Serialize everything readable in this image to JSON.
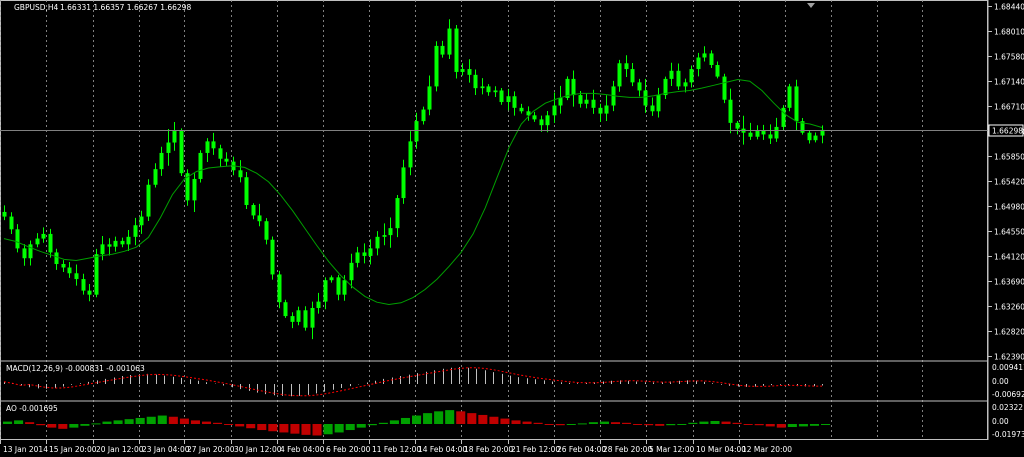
{
  "chart_header": {
    "symbol": "GBPUSD,H4",
    "ohlc": "1.66331 1.66357 1.66267 1.66298"
  },
  "current_price_tag": "1.66298",
  "colors": {
    "background": "#000000",
    "grid": "#a0a0a0",
    "bull_candle": "#00ff00",
    "ma_line": "#00a000",
    "macd_histogram": "#c0c0c0",
    "macd_signal": "#ff0000",
    "ao_up": "#00a000",
    "ao_down": "#c00000",
    "price_line": "#808080",
    "separator": "#c0c0c0"
  },
  "macd_panel": {
    "label": "MACD(12,26,9) -0.000831 -0.001063",
    "axis_labels": [
      "0.009411",
      "0.00",
      "-0.006925"
    ]
  },
  "ao_panel": {
    "label": "AO -0.001695",
    "axis_labels": [
      "0.02322",
      "0.00",
      "-0.019732"
    ]
  },
  "chart_data": {
    "type": "candlestick",
    "title": "GBPUSD,H4",
    "ylim": [
      1.6239,
      1.6844
    ],
    "y_ticks": [
      "1.68440",
      "1.68010",
      "1.67580",
      "1.67140",
      "1.66710",
      "1.66280",
      "1.65850",
      "1.65420",
      "1.64980",
      "1.64550",
      "1.64120",
      "1.63690",
      "1.63260",
      "1.62820",
      "1.62390"
    ],
    "x_ticks": [
      "13 Jan 2014",
      "15 Jan 20:00",
      "20 Jan 12:00",
      "23 Jan 04:00",
      "27 Jan 20:00",
      "30 Jan 12:00",
      "4 Feb 04:00",
      "6 Feb 20:00",
      "11 Feb 12:00",
      "14 Feb 04:00",
      "18 Feb 20:00",
      "21 Feb 12:00",
      "26 Feb 04:00",
      "28 Feb 20:00",
      "5 Mar 12:00",
      "10 Mar 04:00",
      "12 Mar 20:00"
    ],
    "close_path": [
      1.648,
      1.6458,
      1.6425,
      1.6408,
      1.6432,
      1.6442,
      1.645,
      1.6418,
      1.6398,
      1.6392,
      1.6382,
      1.6372,
      1.6352,
      1.6345,
      1.6415,
      1.6432,
      1.6428,
      1.6438,
      1.6432,
      1.6445,
      1.6465,
      1.648,
      1.6535,
      1.6562,
      1.659,
      1.6608,
      1.6628,
      1.6555,
      1.6508,
      1.6545,
      1.659,
      1.661,
      1.6598,
      1.658,
      1.6575,
      1.656,
      1.6548,
      1.65,
      1.6482,
      1.6472,
      1.644,
      1.638,
      1.6332,
      1.6308,
      1.6298,
      1.6318,
      1.6288,
      1.6322,
      1.6333,
      1.637,
      1.6375,
      1.6345,
      1.637,
      1.64,
      1.6418,
      1.6412,
      1.6425,
      1.6445,
      1.6448,
      1.646,
      1.6512,
      1.6565,
      1.661,
      1.6645,
      1.6665,
      1.6705,
      1.6775,
      1.676,
      1.6805,
      1.673,
      1.6735,
      1.6725,
      1.6702,
      1.6705,
      1.6695,
      1.6698,
      1.6678,
      1.6688,
      1.6668,
      1.6662,
      1.6655,
      1.6648,
      1.6638,
      1.6655,
      1.6672,
      1.6685,
      1.6718,
      1.669,
      1.6675,
      1.6682,
      1.6668,
      1.6658,
      1.6672,
      1.6705,
      1.6745,
      1.6735,
      1.6712,
      1.6698,
      1.6672,
      1.6662,
      1.669,
      1.6718,
      1.6732,
      1.6705,
      1.6712,
      1.6735,
      1.6755,
      1.6762,
      1.6742,
      1.6722,
      1.6682,
      1.6642,
      1.6632,
      1.6625,
      1.6618,
      1.6628,
      1.6622,
      1.6615,
      1.6635,
      1.6668,
      1.6705,
      1.6645,
      1.6625,
      1.6612,
      1.662,
      1.66298
    ],
    "ma_path": [
      1.6442,
      1.6437,
      1.6428,
      1.642,
      1.6413,
      1.6406,
      1.6404,
      1.6408,
      1.6412,
      1.6415,
      1.642,
      1.6427,
      1.6444,
      1.6478,
      1.6518,
      1.6545,
      1.6558,
      1.6564,
      1.6566,
      1.6568,
      1.6565,
      1.6555,
      1.654,
      1.6517,
      1.649,
      1.646,
      1.643,
      1.6402,
      1.6378,
      1.6358,
      1.6342,
      1.6332,
      1.6328,
      1.6331,
      1.634,
      1.6354,
      1.6372,
      1.6394,
      1.6418,
      1.645,
      1.6495,
      1.6548,
      1.66,
      1.664,
      1.6662,
      1.6676,
      1.6684,
      1.669,
      1.6693,
      1.6693,
      1.6691,
      1.6688,
      1.6686,
      1.6686,
      1.6689,
      1.6693,
      1.6696,
      1.6698,
      1.6702,
      1.6707,
      1.6712,
      1.6717,
      1.6714,
      1.6698,
      1.6676,
      1.6656,
      1.6643,
      1.664,
      1.6634
    ],
    "macd_values": [
      0.0012,
      0.0004,
      -0.0008,
      -0.0018,
      -0.0024,
      -0.0026,
      -0.0022,
      -0.0014,
      -0.0004,
      0.0004,
      0.0012,
      0.002,
      0.0028,
      0.0036,
      0.0044,
      0.005,
      0.0054,
      0.0056,
      0.0052,
      0.0046,
      0.004,
      0.0034,
      0.0026,
      0.0018,
      0.001,
      0.0002,
      -0.0008,
      -0.0018,
      -0.0028,
      -0.0038,
      -0.0048,
      -0.0056,
      -0.0062,
      -0.0066,
      -0.0068,
      -0.0066,
      -0.006,
      -0.0052,
      -0.0042,
      -0.0032,
      -0.0022,
      -0.0012,
      -0.0002,
      0.0008,
      0.0018,
      0.0028,
      0.0036,
      0.0044,
      0.0052,
      0.006,
      0.0068,
      0.0076,
      0.0084,
      0.009,
      0.0094,
      0.009,
      0.0084,
      0.0076,
      0.0066,
      0.0056,
      0.0046,
      0.0038,
      0.0032,
      0.0026,
      0.002,
      0.0014,
      0.001,
      0.0006,
      0.0004,
      0.0006,
      0.001,
      0.0014,
      0.0018,
      0.002,
      0.0018,
      0.0014,
      0.001,
      0.0008,
      0.001,
      0.0014,
      0.0018,
      0.002,
      0.0018,
      0.0012,
      0.0004,
      -0.0004,
      -0.001,
      -0.0014,
      -0.0016,
      -0.0014,
      -0.001,
      -0.0006,
      -0.0004,
      -0.0008,
      -0.0012,
      -0.0014,
      -0.0012,
      -0.0008
    ],
    "ao_values": [
      0.004,
      0.006,
      0.003,
      -0.002,
      -0.006,
      -0.008,
      -0.006,
      -0.003,
      0.001,
      0.004,
      0.006,
      0.008,
      0.01,
      0.012,
      0.014,
      0.012,
      0.009,
      0.006,
      0.004,
      0.002,
      -0.001,
      -0.004,
      -0.007,
      -0.01,
      -0.012,
      -0.014,
      -0.016,
      -0.018,
      -0.019,
      -0.017,
      -0.014,
      -0.01,
      -0.006,
      -0.002,
      0.002,
      0.006,
      0.01,
      0.014,
      0.018,
      0.021,
      0.023,
      0.021,
      0.018,
      0.015,
      0.012,
      0.009,
      0.006,
      0.004,
      0.002,
      0.0,
      -0.002,
      -0.001,
      0.001,
      0.003,
      0.004,
      0.003,
      0.002,
      0.0,
      -0.002,
      -0.003,
      -0.002,
      0.0,
      0.002,
      0.004,
      0.005,
      0.004,
      0.002,
      0.0,
      -0.002,
      -0.004,
      -0.006,
      -0.005,
      -0.004,
      -0.003,
      -0.0017
    ]
  }
}
